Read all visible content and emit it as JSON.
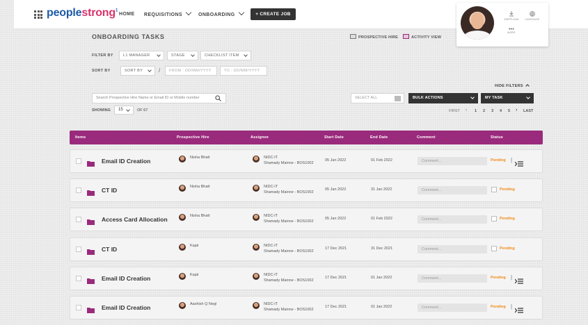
{
  "brand": {
    "part1": "people",
    "part2": "strong",
    "mark": "1"
  },
  "nav": {
    "home": "HOME",
    "requisitions": "REQUISITIONS",
    "onboarding": "ONBOARDING",
    "create_job": "+ CREATE JOB"
  },
  "profile": {
    "icons": [
      {
        "label": "EMPPLOAD",
        "icon": "download-icon"
      },
      {
        "label": "LANGUAGE",
        "icon": "globe-icon"
      }
    ],
    "more_label": "MORE"
  },
  "page": {
    "title": "ONBOARDING TASKS",
    "views": [
      {
        "label": "PROSPECTIVE HIRE",
        "active": false
      },
      {
        "label": "ACTIVITY VIEW",
        "active": true
      }
    ]
  },
  "filters": {
    "filter_by_label": "FILTER BY",
    "sort_by_label": "SORT BY",
    "manager": "L1 MANAGER",
    "stage": "STAGE",
    "checklist": "CHECKLIST ITEM",
    "sort": "SORT BY",
    "from_placeholder": "FROM : DD/MM/YYYY",
    "to_placeholder": "TO : DD/MM/YYYY",
    "hide_filters": "HIDE FILTERS"
  },
  "toolbar": {
    "search_placeholder": "Search Prospective Hire Name or Email ID or Mobile number",
    "select_all": "SELECT ALL",
    "bulk_actions": "BULK ACTIONS",
    "my_task": "MY TASK"
  },
  "pagination": {
    "showing_label": "SHOWING",
    "page_size": "15",
    "of_total": "OF 67",
    "first": "FIRST",
    "last": "LAST",
    "pages": [
      "1",
      "2",
      "3",
      "4",
      "5"
    ]
  },
  "table": {
    "columns": [
      "Items",
      "Prospective Hire",
      "Assignee",
      "Start Date",
      "End Date",
      "Comment",
      "Status"
    ],
    "comment_placeholder": "Comment...",
    "rows": [
      {
        "item": "Email ID Creation",
        "hire": "Nisha Bhatt",
        "assignee_team": "NIDC-IT",
        "assignee_name": "Shamady Mainne - BOS1002",
        "start": "05 Jan 2022",
        "end": "01 Feb 2022",
        "status": "Pending",
        "has_actions": true
      },
      {
        "item": "CT ID",
        "hire": "Nisha Bhatt",
        "assignee_team": "NIDC-IT",
        "assignee_name": "Shamady Mainne - BOS1002",
        "start": "05 Jan 2022",
        "end": "31 Jan 2022",
        "status": "Pending",
        "has_actions": false
      },
      {
        "item": "Access Card Allocation",
        "hire": "Nisha Bhatt",
        "assignee_team": "NIDC-IT",
        "assignee_name": "Shamady Mainne - BOS1002",
        "start": "05 Jan 2022",
        "end": "01 Feb 2022",
        "status": "Pending",
        "has_actions": false
      },
      {
        "item": "CT ID",
        "hire": "Kajal",
        "assignee_team": "NIDC-IT",
        "assignee_name": "Shamady Mainne - BOS1002",
        "start": "17 Dec 2021",
        "end": "31 Dec 2021",
        "status": "Pending",
        "has_actions": false
      },
      {
        "item": "Email ID Creation",
        "hire": "Kajal",
        "assignee_team": "NIDC-IT",
        "assignee_name": "Shamady Mainne - BOS1002",
        "start": "17 Dec 2021",
        "end": "01 Jan 2022",
        "status": "Pending",
        "has_actions": true
      },
      {
        "item": "Email ID Creation",
        "hire": "Aashish Q Negi",
        "assignee_team": "NIDC-IT",
        "assignee_name": "Shamady Mainne - BOS1002",
        "start": "17 Dec 2021",
        "end": "01 Jan 2022",
        "status": "Pending",
        "has_actions": true
      }
    ]
  },
  "colors": {
    "accent": "#9a2a7c",
    "pending": "#f08c1a",
    "logo_blue": "#1d5aa8",
    "logo_pink": "#d8336b"
  }
}
